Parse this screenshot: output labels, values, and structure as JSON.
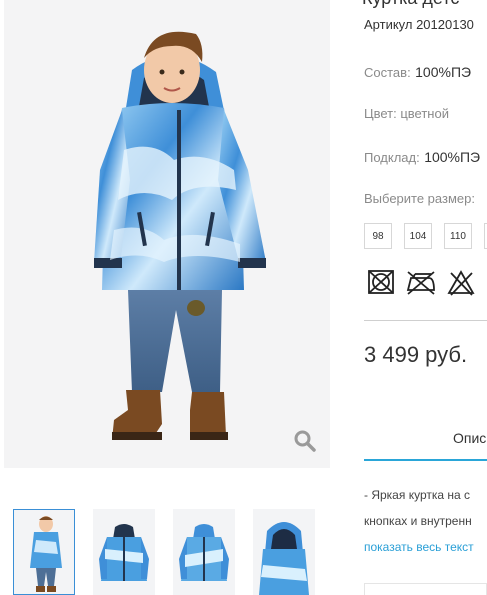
{
  "product": {
    "title": "Куртка детс",
    "sku": "Артикул 20120130",
    "composition_label": "Состав:",
    "composition_value": "100%ПЭ",
    "color_text": "Цвет: цветной",
    "lining_label": "Подклад:",
    "lining_value": "100%ПЭ",
    "size_prompt": "Выберите размер:",
    "sizes": [
      "98",
      "104",
      "110"
    ],
    "price": "3 499 руб."
  },
  "care_icons": [
    "no-tumble-dry-icon",
    "no-ironing-icon",
    "no-bleach-icon"
  ],
  "tabs": {
    "description_label": "Опис"
  },
  "description": {
    "line1": "- Яркая куртка на с",
    "line2": "кнопках и внутренн",
    "show_all": "показать весь текст"
  },
  "gallery": {
    "thumbnails": [
      "thumbnail-child-wearing-jacket",
      "thumbnail-jacket-front",
      "thumbnail-jacket-front-open",
      "thumbnail-jacket-back"
    ],
    "active_index": 0
  },
  "colors": {
    "accent": "#2aa6d8",
    "link": "#2a9fd6",
    "jacket_blue": "#4a9fe0"
  }
}
